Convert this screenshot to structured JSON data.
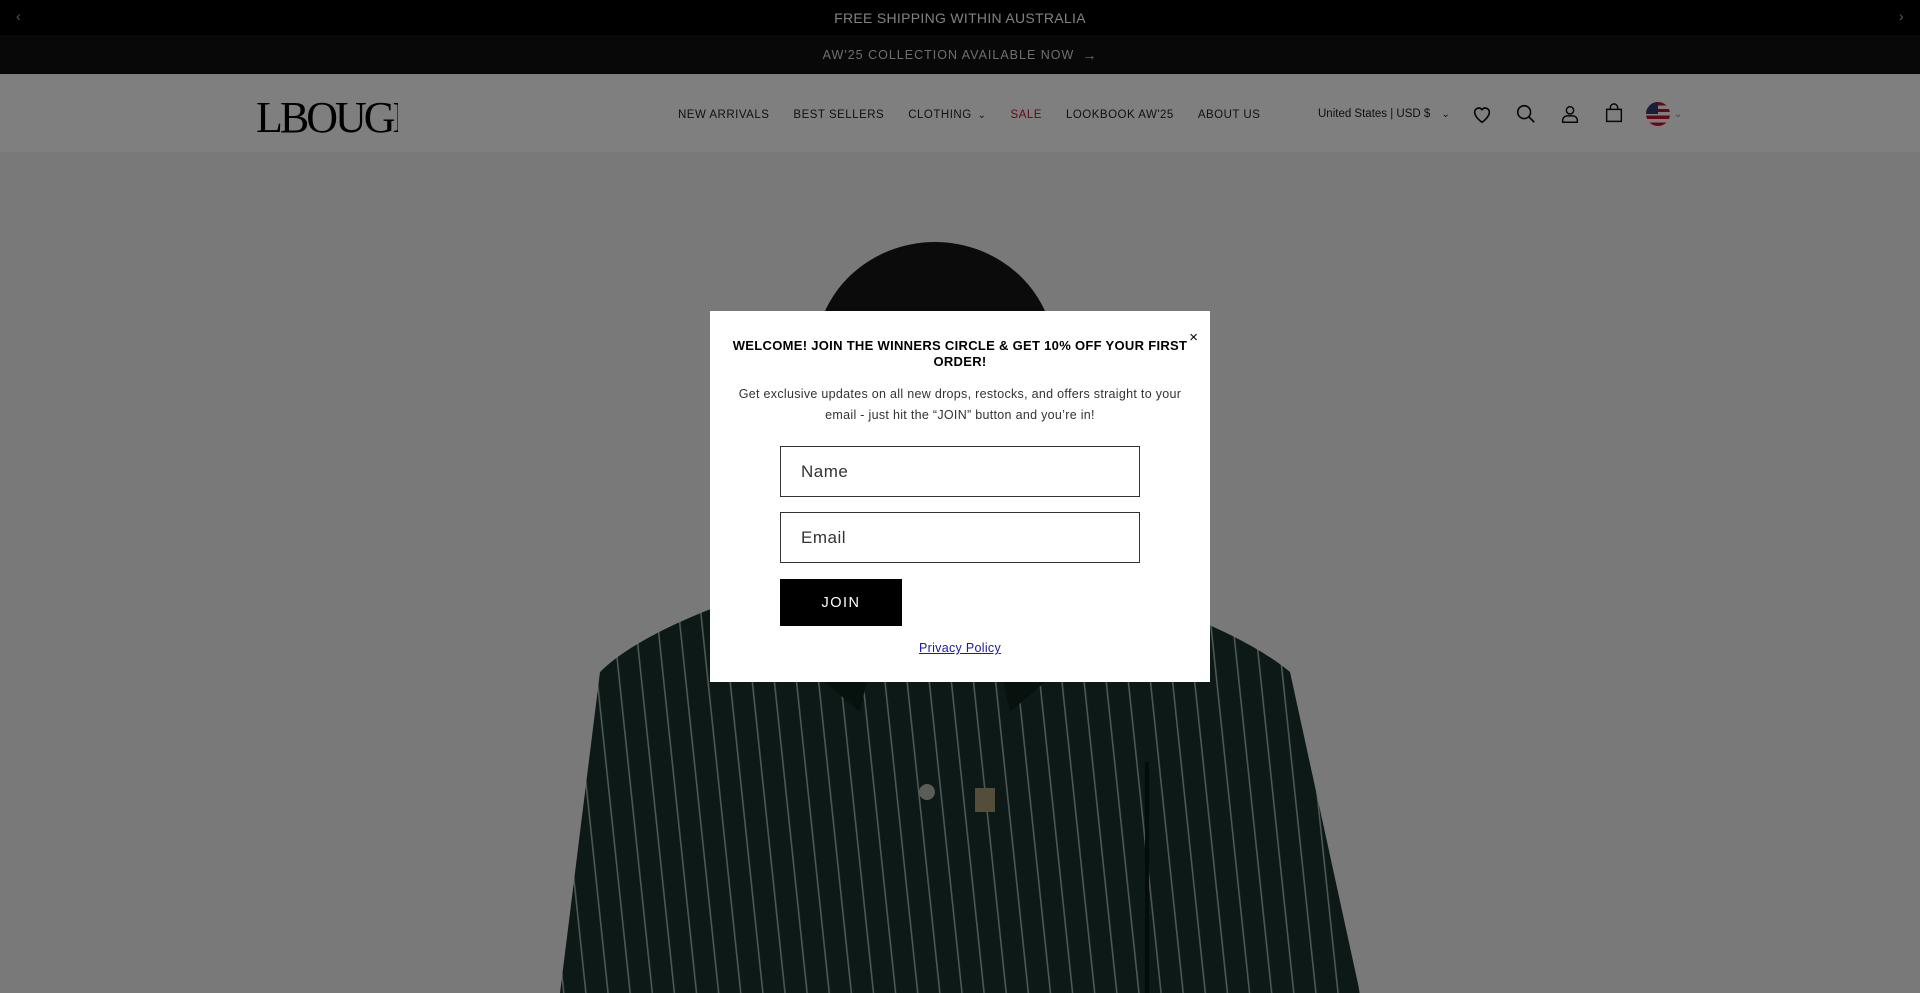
{
  "announcement_bar": {
    "text": "FREE SHIPPING WITHIN AUSTRALIA",
    "prev_glyph": "‹",
    "next_glyph": "›"
  },
  "sub_announcement": {
    "text": "AW'25 COLLECTION AVAILABLE NOW",
    "arrow": "→"
  },
  "header": {
    "logo_text": "LBOUGE",
    "nav": [
      {
        "label": "NEW ARRIVALS"
      },
      {
        "label": "BEST SELLERS"
      },
      {
        "label": "CLOTHING",
        "chevron": "⌄"
      },
      {
        "label": "SALE"
      },
      {
        "label": "LOOKBOOK AW'25"
      },
      {
        "label": "ABOUT US"
      }
    ],
    "country_selector": {
      "value": "United States | USD $",
      "chevron": "⌄"
    },
    "icons": [
      "heart-icon",
      "search-icon",
      "account-icon",
      "cart-icon",
      "flag-icon"
    ]
  },
  "modal": {
    "close_glyph": "×",
    "title": "WELCOME! JOIN THE WINNERS CIRCLE & GET 10% OFF YOUR FIRST ORDER!",
    "description": "Get exclusive updates on all new drops, restocks, and offers straight to your email - just hit the “JOIN” button and you’re in!",
    "name_placeholder": "Name",
    "email_placeholder": "Email",
    "join_label": "JOIN",
    "privacy_label": "Privacy Policy"
  },
  "colors": {
    "sale": "#c8102e",
    "overlay": "rgba(0,0,0,0.5)",
    "privacy_link": "#1a1aa6"
  }
}
